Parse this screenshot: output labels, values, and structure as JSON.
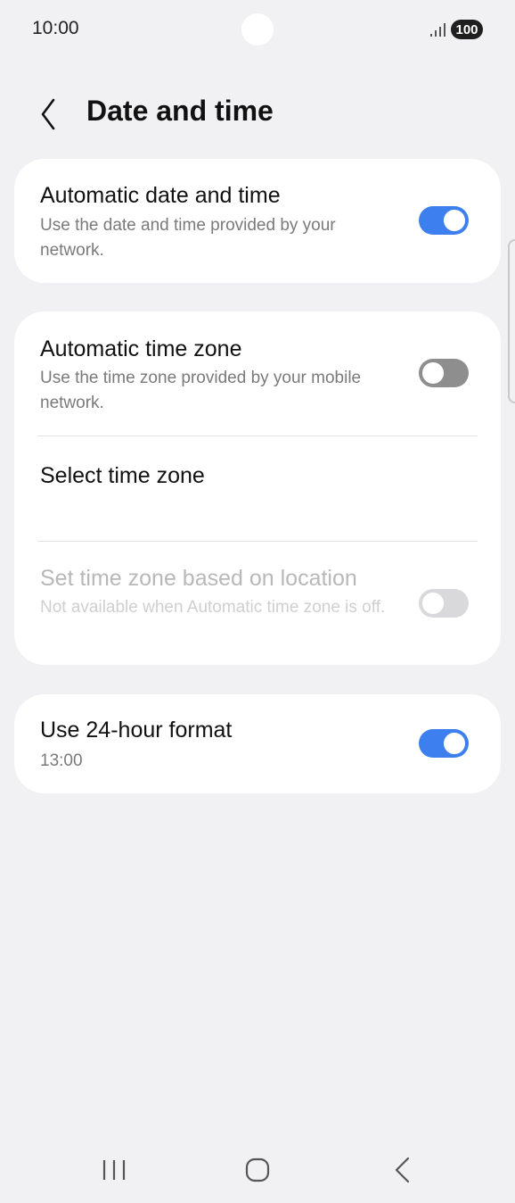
{
  "status_bar": {
    "time": "10:00",
    "battery_level": "100",
    "signal_icon": "signal-bars-icon"
  },
  "header": {
    "back_icon": "chevron-left-icon",
    "title": "Date and time"
  },
  "settings": {
    "automatic_date_time": {
      "title": "Automatic date and time",
      "subtitle": "Use the date and time provided by your network.",
      "enabled": true
    },
    "automatic_time_zone": {
      "title": "Automatic time zone",
      "subtitle": "Use the time zone provided by your mobile network.",
      "enabled": false
    },
    "select_time_zone": {
      "title": "Select time zone"
    },
    "location_time_zone": {
      "title": "Set time zone based on location",
      "subtitle": "Not available when Automatic time zone is off.",
      "enabled": false,
      "available": false
    },
    "use_24_hour": {
      "title": "Use 24-hour format",
      "subtitle": "13:00",
      "enabled": true
    }
  },
  "colors": {
    "accent": "#3e7ff0",
    "background": "#f1f1f3",
    "card": "#ffffff",
    "toggle_off": "#8e8e8e",
    "toggle_disabled": "#d9d9dc"
  },
  "nav_bar": {
    "recents_icon": "recents-icon",
    "home_icon": "home-icon",
    "back_icon": "back-icon"
  }
}
